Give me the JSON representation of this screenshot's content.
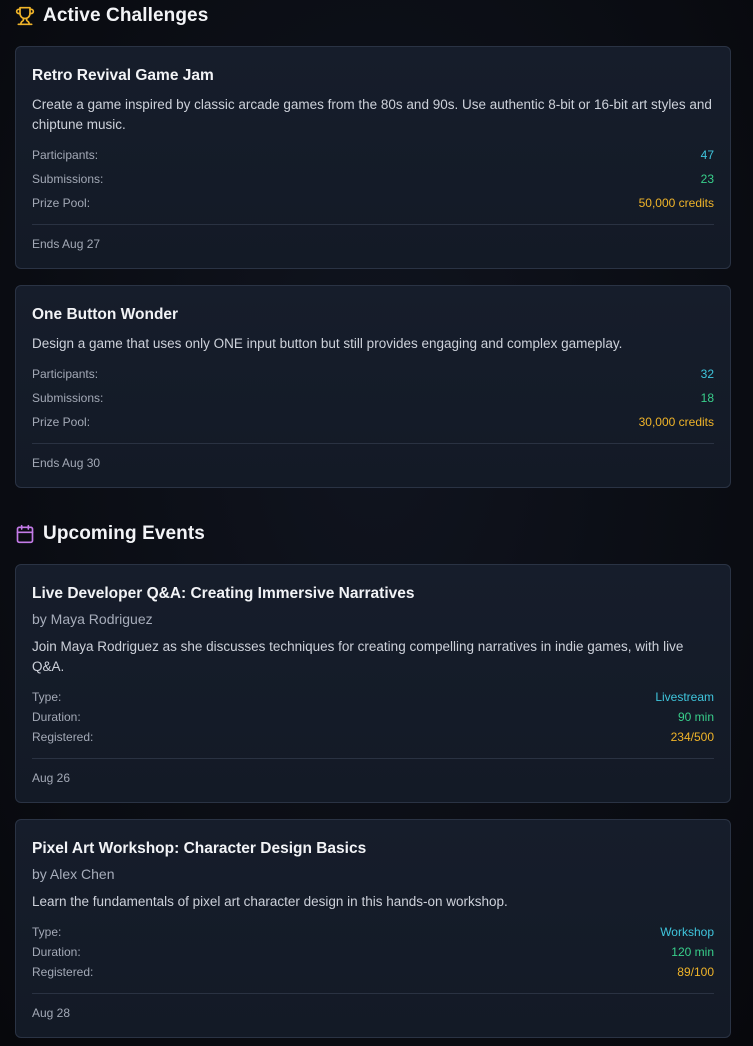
{
  "challenges": {
    "heading": "Active Challenges",
    "icon": "trophy-icon",
    "items": [
      {
        "title": "Retro Revival Game Jam",
        "description": "Create a game inspired by classic arcade games from the 80s and 90s. Use authentic 8-bit or 16-bit art styles and chiptune music.",
        "participants_label": "Participants:",
        "participants": "47",
        "submissions_label": "Submissions:",
        "submissions": "23",
        "prize_label": "Prize Pool:",
        "prize": "50,000 credits",
        "ends": "Ends Aug 27"
      },
      {
        "title": "One Button Wonder",
        "description": "Design a game that uses only ONE input button but still provides engaging and complex gameplay.",
        "participants_label": "Participants:",
        "participants": "32",
        "submissions_label": "Submissions:",
        "submissions": "18",
        "prize_label": "Prize Pool:",
        "prize": "30,000 credits",
        "ends": "Ends Aug 30"
      }
    ]
  },
  "events": {
    "heading": "Upcoming Events",
    "icon": "calendar-icon",
    "items": [
      {
        "title": "Live Developer Q&A: Creating Immersive Narratives",
        "author": "by Maya Rodriguez",
        "description": "Join Maya Rodriguez as she discusses techniques for creating compelling narratives in indie games, with live Q&A.",
        "type_label": "Type:",
        "type": "Livestream",
        "duration_label": "Duration:",
        "duration": "90 min",
        "registered_label": "Registered:",
        "registered": "234/500",
        "date": "Aug 26"
      },
      {
        "title": "Pixel Art Workshop: Character Design Basics",
        "author": "by Alex Chen",
        "description": "Learn the fundamentals of pixel art character design in this hands-on workshop.",
        "type_label": "Type:",
        "type": "Workshop",
        "duration_label": "Duration:",
        "duration": "120 min",
        "registered_label": "Registered:",
        "registered": "89/100",
        "date": "Aug 28"
      }
    ]
  },
  "colors": {
    "accent_cyan": "#3fc5dc",
    "accent_green": "#38cf8b",
    "accent_gold": "#f0b429",
    "trophy": "#f0b429",
    "calendar": "#c47be8"
  }
}
